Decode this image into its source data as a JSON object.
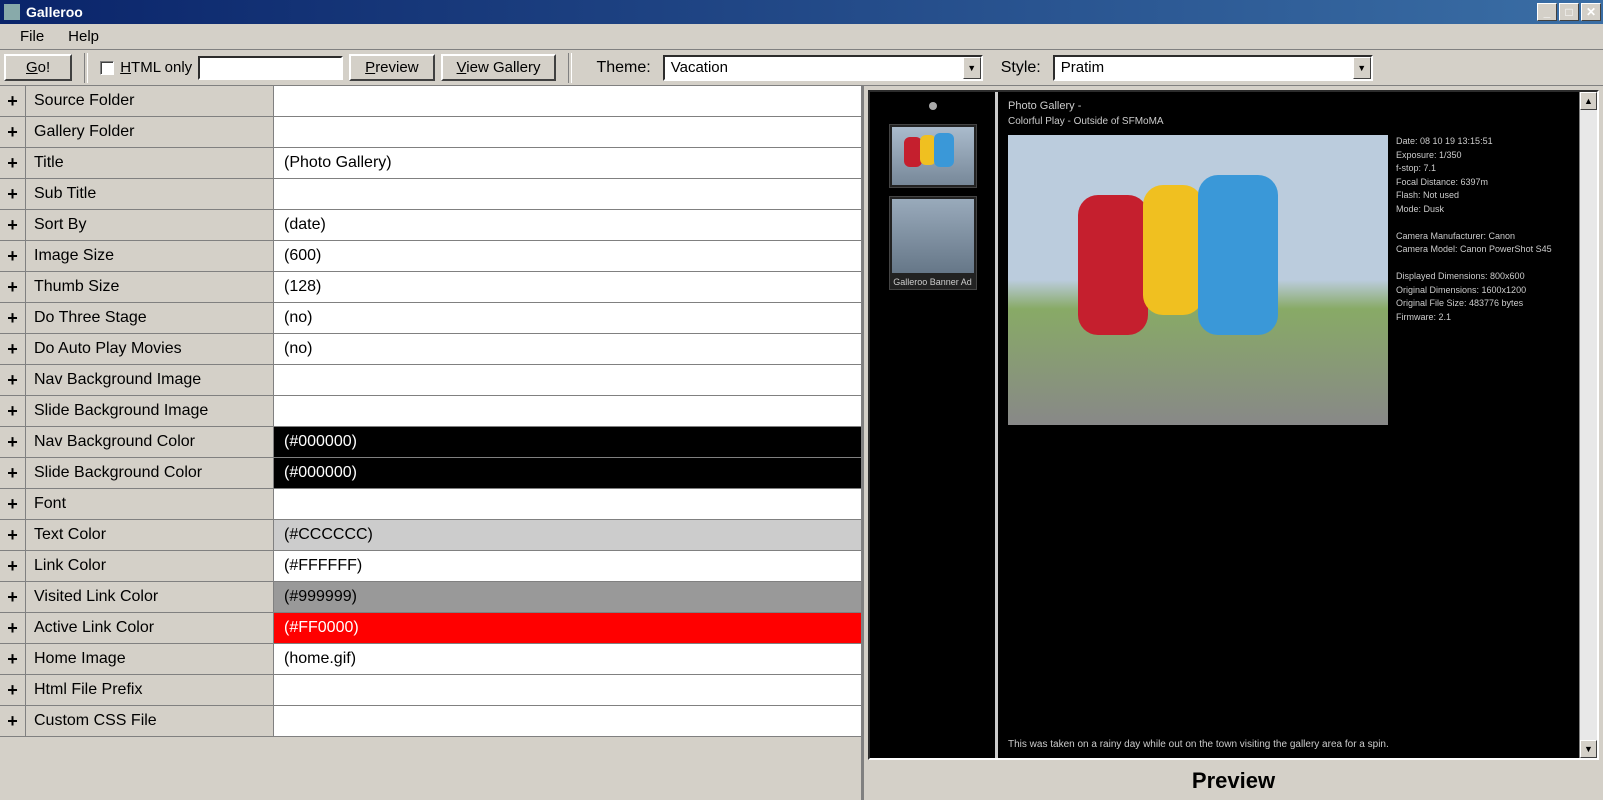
{
  "window": {
    "title": "Galleroo"
  },
  "menu": {
    "file": "File",
    "help": "Help"
  },
  "toolbar": {
    "go": "Go!",
    "html_only": "HTML only",
    "preview": "Preview",
    "view_gallery": "View Gallery",
    "theme_label": "Theme:",
    "theme_value": "Vacation",
    "style_label": "Style:",
    "style_value": "Pratim"
  },
  "props": [
    {
      "label": "Source Folder",
      "value": "",
      "bg": "#ffffff",
      "fg": "#000000"
    },
    {
      "label": "Gallery Folder",
      "value": "",
      "bg": "#ffffff",
      "fg": "#000000"
    },
    {
      "label": "Title",
      "value": "(Photo Gallery)",
      "bg": "#ffffff",
      "fg": "#000000"
    },
    {
      "label": "Sub Title",
      "value": "",
      "bg": "#ffffff",
      "fg": "#000000"
    },
    {
      "label": "Sort By",
      "value": "(date)",
      "bg": "#ffffff",
      "fg": "#000000"
    },
    {
      "label": "Image Size",
      "value": "(600)",
      "bg": "#ffffff",
      "fg": "#000000"
    },
    {
      "label": "Thumb Size",
      "value": "(128)",
      "bg": "#ffffff",
      "fg": "#000000"
    },
    {
      "label": "Do Three Stage",
      "value": "(no)",
      "bg": "#ffffff",
      "fg": "#000000"
    },
    {
      "label": "Do Auto Play Movies",
      "value": "(no)",
      "bg": "#ffffff",
      "fg": "#000000"
    },
    {
      "label": "Nav Background Image",
      "value": "",
      "bg": "#ffffff",
      "fg": "#000000"
    },
    {
      "label": "Slide Background Image",
      "value": "",
      "bg": "#ffffff",
      "fg": "#000000"
    },
    {
      "label": "Nav Background Color",
      "value": "(#000000)",
      "bg": "#000000",
      "fg": "#ffffff"
    },
    {
      "label": "Slide Background Color",
      "value": "(#000000)",
      "bg": "#000000",
      "fg": "#ffffff"
    },
    {
      "label": "Font",
      "value": "",
      "bg": "#ffffff",
      "fg": "#000000"
    },
    {
      "label": "Text Color",
      "value": "(#CCCCCC)",
      "bg": "#cccccc",
      "fg": "#000000"
    },
    {
      "label": "Link Color",
      "value": "(#FFFFFF)",
      "bg": "#ffffff",
      "fg": "#000000"
    },
    {
      "label": "Visited Link Color",
      "value": "(#999999)",
      "bg": "#999999",
      "fg": "#000000"
    },
    {
      "label": "Active Link Color",
      "value": "(#FF0000)",
      "bg": "#ff0000",
      "fg": "#ffffff"
    },
    {
      "label": "Home Image",
      "value": "(home.gif)",
      "bg": "#ffffff",
      "fg": "#000000"
    },
    {
      "label": "Html File Prefix",
      "value": "",
      "bg": "#ffffff",
      "fg": "#000000"
    },
    {
      "label": "Custom CSS File",
      "value": "",
      "bg": "#ffffff",
      "fg": "#000000"
    }
  ],
  "preview": {
    "label": "Preview",
    "gallery_title": "Photo Gallery -",
    "gallery_sub": "Colorful Play - Outside of SFMoMA",
    "thumb2_caption": "Galleroo Banner Ad",
    "meta": [
      "Date: 08 10 19 13:15:51",
      "Exposure: 1/350",
      "f-stop: 7.1",
      "Focal Distance: 6397m",
      "Flash: Not used",
      "Mode: Dusk",
      "",
      "Camera Manufacturer: Canon",
      "Camera Model: Canon PowerShot S45",
      "",
      "Displayed Dimensions: 800x600",
      "Original Dimensions: 1600x1200",
      "Original File Size: 483776 bytes",
      "Firmware: 2.1"
    ],
    "description": "This was taken on a rainy day while out on the town visiting the gallery area for a spin."
  }
}
